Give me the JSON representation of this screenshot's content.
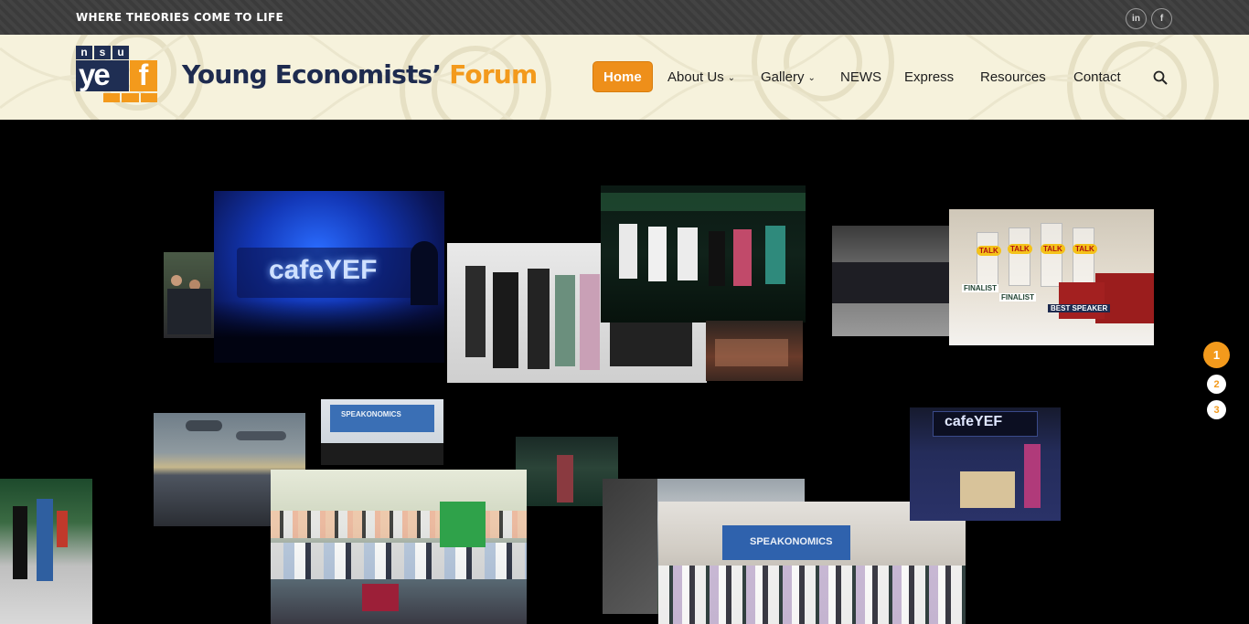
{
  "topbar": {
    "tagline": "WHERE THEORIES COME TO LIFE",
    "social": [
      {
        "icon": "linkedin-icon",
        "glyph": "in"
      },
      {
        "icon": "facebook-icon",
        "glyph": "f"
      }
    ]
  },
  "header": {
    "logo": {
      "nsu": [
        "n",
        "s",
        "u"
      ],
      "ye": "ye",
      "f": "f"
    },
    "title_main": "Young Economists’ ",
    "title_accent": "Forum",
    "nav": [
      {
        "label": "Home",
        "active": true
      },
      {
        "label": "About Us",
        "dropdown": true
      },
      {
        "label": "Gallery",
        "dropdown": true
      },
      {
        "label": "NEWS"
      },
      {
        "label": "Express"
      },
      {
        "label": "Resources"
      },
      {
        "label": "Contact"
      }
    ],
    "search_icon": "search-icon"
  },
  "gallery": {
    "photo_labels": {
      "cafe_sign": "cafeYEF",
      "banner_1": "SPEAKONOMICS",
      "banner_2": "SPEAKONOMICS",
      "cafe_stall": "cafeYEF",
      "trophy_1": "FINALIST",
      "trophy_2": "FINALIST",
      "trophy_3": "BEST SPEAKER",
      "trophy_brand": "TALK"
    },
    "pagination": [
      "1",
      "2",
      "3"
    ],
    "current_page": "1"
  },
  "colors": {
    "accent": "#f39a1c",
    "navy": "#1e2b4f",
    "topbar": "#3d3d3d",
    "header_bg": "#f6f2dc"
  }
}
